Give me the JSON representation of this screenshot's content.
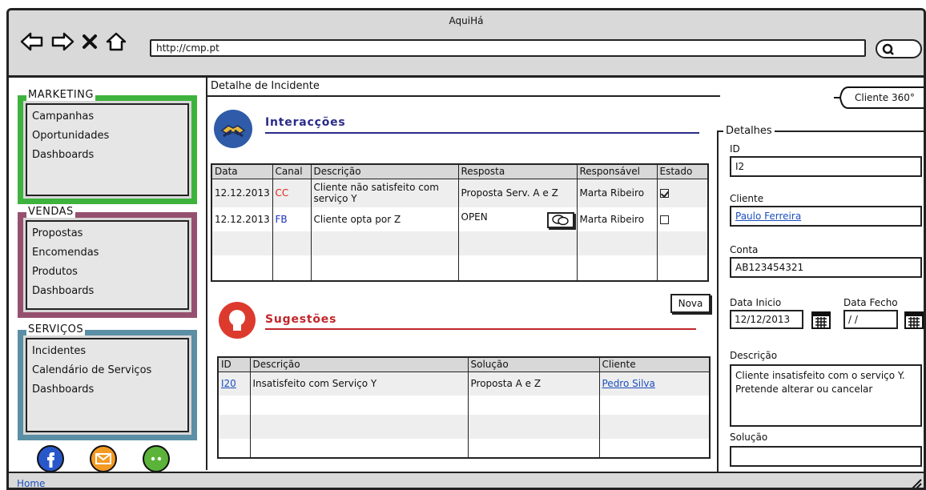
{
  "window": {
    "title": "AquiHá"
  },
  "browser": {
    "url": "http://cmp.pt"
  },
  "sidebar": {
    "groups": [
      {
        "title": "MARKETING",
        "color": "#3db33d",
        "items": [
          "Campanhas",
          "Oportunidades",
          "Dashboards"
        ]
      },
      {
        "title": "VENDAS",
        "color": "#96506f",
        "items": [
          "Propostas",
          "Encomendas",
          "Produtos",
          "Dashboards"
        ]
      },
      {
        "title": "SERVIÇOS",
        "color": "#5b8fa5",
        "items": [
          "Incidentes",
          "Calendário de Serviços",
          "Dashboards"
        ]
      }
    ],
    "social_icons": [
      "facebook-icon",
      "email-icon",
      "chat-icon"
    ]
  },
  "status": {
    "home_link": "Home"
  },
  "main": {
    "page_title": "Detalhe de Incidente",
    "tab_360": "Cliente 360°",
    "interactions": {
      "title": "Interacções",
      "accent": "#2b2b8a",
      "columns": [
        "Data",
        "Canal",
        "Descrição",
        "Resposta",
        "Responsável",
        "Estado"
      ],
      "rows": [
        {
          "data": "12.12.2013",
          "canal": "CC",
          "descricao": "Cliente não satisfeito com serviço Y",
          "resposta": "Proposta Serv. A e Z",
          "responsavel": "Marta Ribeiro",
          "estado": true
        },
        {
          "data": "12.12.2013",
          "canal": "FB",
          "descricao": "Cliente opta por Z",
          "resposta": "OPEN",
          "responsavel": "Marta Ribeiro",
          "estado": false
        }
      ],
      "new_button": "Nova"
    },
    "suggestions": {
      "title": "Sugestões",
      "accent": "#c0262a",
      "columns": [
        "ID",
        "Descrição",
        "Solução",
        "Cliente"
      ],
      "rows": [
        {
          "id": "I20",
          "descricao": "Insatisfeito com Serviço Y",
          "solucao": "Proposta A e Z",
          "cliente": "Pedro Silva"
        }
      ]
    },
    "details": {
      "legend": "Detalhes",
      "id_label": "ID",
      "id_value": "I2",
      "cliente_label": "Cliente",
      "cliente_value": "Paulo Ferreira",
      "conta_label": "Conta",
      "conta_value": "AB123454321",
      "data_inicio_label": "Data Inicio",
      "data_inicio_value": "12/12/2013",
      "data_fecho_label": "Data Fecho",
      "data_fecho_value": " / /",
      "descricao_label": "Descrição",
      "descricao_value": "Cliente insatisfeito com o serviço Y. Pretende alterar ou cancelar",
      "solucao_label": "Solução",
      "solucao_value": ""
    }
  }
}
